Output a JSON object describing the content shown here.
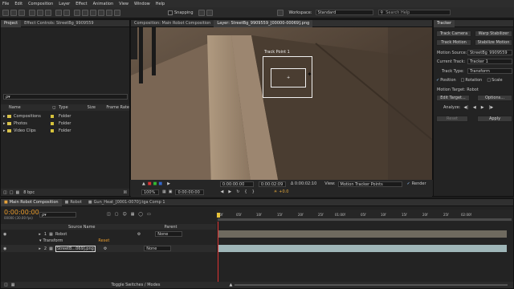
{
  "menu": [
    "File",
    "Edit",
    "Composition",
    "Layer",
    "Effect",
    "Animation",
    "View",
    "Window",
    "Help"
  ],
  "toolbar": {
    "snapping": "Snapping",
    "workspace_label": "Workspace:",
    "workspace_value": "Standard",
    "search_placeholder": "Search Help"
  },
  "project_panel": {
    "tab_project": "Project",
    "tab_effect": "Effect Controls: StreetBg_9909559",
    "search_value": "ρ▾",
    "columns": [
      "Name",
      "Type",
      "Size",
      "Frame Rate"
    ],
    "items": [
      {
        "name": "Compositions",
        "type": "Folder"
      },
      {
        "name": "Photos",
        "type": "Folder"
      },
      {
        "name": "Video Clips",
        "type": "Folder"
      }
    ],
    "bpc": "8 bpc"
  },
  "viewer": {
    "tab_comp": "Composition: Main Robot Composition",
    "tab_layer": "Layer: StreetBg_9909559_[00000-00069].png",
    "track_point": "Track Point 1",
    "ruler": [
      "00f",
      "05f",
      "10f",
      "15f",
      "20f",
      "01:00f",
      "05f",
      "10f",
      "15f",
      "20f",
      "02:00f",
      "05f",
      "10f"
    ],
    "zoom": "100%",
    "timecode": "0:00:00:00",
    "in_time": "0:00:00:00",
    "duration": "0:00:02:09",
    "out_time": "Δ 0:00:02:10",
    "view_label": "View:",
    "view_value": "Motion Tracker Points",
    "render_label": "Render",
    "offset": "+0.0"
  },
  "tracker": {
    "tab": "Tracker",
    "btn_track_camera": "Track Camera",
    "btn_warp": "Warp Stabilizer",
    "btn_track_motion": "Track Motion",
    "btn_stabilize": "Stabilize Motion",
    "motion_source_label": "Motion Source:",
    "motion_source_value": "StreetBg_9909559",
    "current_track_label": "Current Track:",
    "current_track_value": "Tracker 1",
    "track_type_label": "Track Type:",
    "track_type_value": "Transform",
    "cb_position": "Position",
    "cb_rotation": "Rotation",
    "cb_scale": "Scale",
    "motion_target": "Motion Target: Robot",
    "edit_target": "Edit Target...",
    "options": "Options...",
    "analyze_label": "Analyze:",
    "reset": "Reset",
    "apply": "Apply"
  },
  "timeline": {
    "tabs": [
      "Main Robot Composition",
      "Robot",
      "Gun_Heat_[0001-0070].tga Comp 1"
    ],
    "timecode": "0:00:00:00",
    "frame_info": "00000 (30.00 fps)",
    "search_value": "ρ▾",
    "col_source": "Source Name",
    "col_parent": "Parent",
    "ruler": [
      "00f",
      "05f",
      "10f",
      "15f",
      "20f",
      "25f",
      "01:00f",
      "05f",
      "10f",
      "15f",
      "20f",
      "25f",
      "02:00f"
    ],
    "layers": [
      {
        "num": "1",
        "name": "Robot",
        "parent": "None"
      },
      {
        "num": "2",
        "name": "StreetB...069].png",
        "parent": "None"
      }
    ],
    "transform": "Transform",
    "reset": "Reset",
    "toggle": "Toggle Switches / Modes"
  }
}
